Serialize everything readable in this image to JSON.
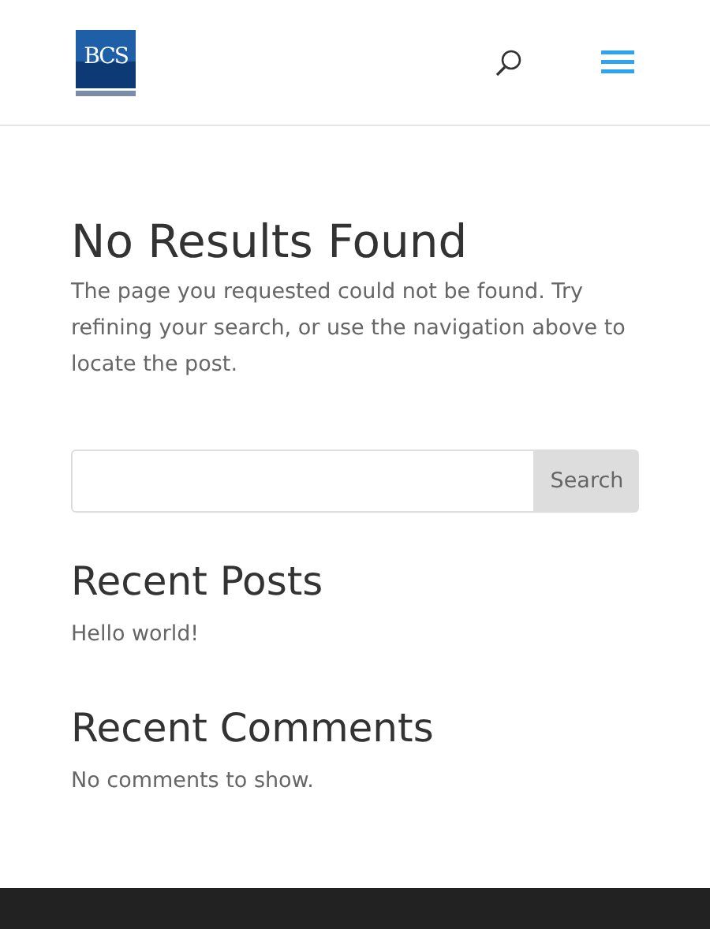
{
  "header": {
    "logo": {
      "text": "BCS"
    }
  },
  "main": {
    "title": "No Results Found",
    "message": "The page you requested could not be found. Try refining your search, or use the navigation above to locate the post."
  },
  "search": {
    "button": "Search"
  },
  "recent_posts": {
    "title": "Recent Posts",
    "items": [
      "Hello world!"
    ]
  },
  "recent_comments": {
    "title": "Recent Comments",
    "empty": "No comments to show."
  }
}
